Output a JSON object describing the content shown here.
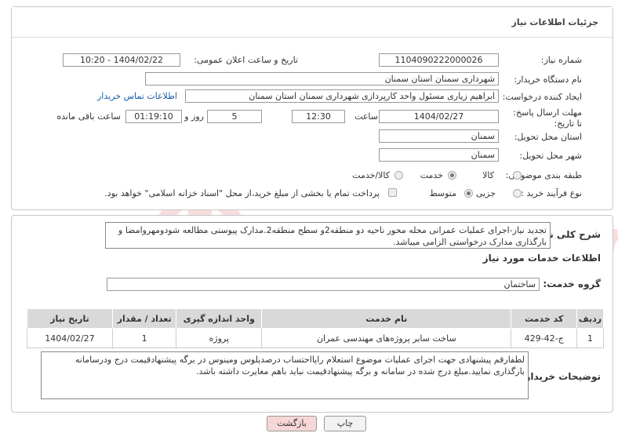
{
  "header": {
    "title": "جزئیات اطلاعات نیاز"
  },
  "form": {
    "need_number_label": "شماره نیاز:",
    "need_number": "1104090222000026",
    "announce_label": "تاریخ و ساعت اعلان عمومی:",
    "announce_value": "1404/02/22 - 10:20",
    "buyer_org_label": "نام دستگاه خریدار:",
    "buyer_org": "شهرداری سمنان استان سمنان",
    "creator_label": "ایجاد کننده درخواست:",
    "creator": "ابراهیم زیاری مسئول واحد کارپردازی شهرداری سمنان استان سمنان",
    "contact_link": "اطلاعات تماس خریدار",
    "deadline_label": "مهلت ارسال پاسخ: تا تاریخ:",
    "deadline_date": "1404/02/27",
    "time_label": "ساعت",
    "deadline_time": "12:30",
    "days_value": "5",
    "days_label": "روز و",
    "remaining_time": "01:19:10",
    "remaining_label": "ساعت باقی مانده",
    "province_label": "استان محل تحویل:",
    "province": "سمنان",
    "city_label": "شهر محل تحویل:",
    "city": "سمنان",
    "category_label": "طبقه بندی موضوعی:",
    "category_options": [
      "کالا",
      "خدمت",
      "کالا/خدمت"
    ],
    "category_selected": "خدمت",
    "process_label": "نوع فرآیند خرید :",
    "process_options": [
      "جزیی",
      "متوسط"
    ],
    "process_selected": "متوسط",
    "payment_text": "پرداخت تمام یا بخشی از مبلغ خرید،از محل \"اسناد خزانه اسلامی\" خواهد بود."
  },
  "summary": {
    "label": "شرح کلی نیاز:",
    "text": "تجدید نیاز-اجرای عملیات عمرانی محله محور ناحیه دو منطقه2و سطح منطقه2.مدارک پیوستی مطالعه شودومهروامضا و بارگذاری مدارک درخواستی الزامی میباشد."
  },
  "services": {
    "section_title": "اطلاعات خدمات مورد نیاز",
    "group_label": "گروه خدمت:",
    "group_value": "ساختمان",
    "columns": [
      "ردیف",
      "کد خدمت",
      "نام خدمت",
      "واحد اندازه گیری",
      "تعداد / مقدار",
      "تاریخ نیاز"
    ],
    "rows": [
      {
        "row": "1",
        "code": "ج-42-429",
        "name": "ساخت سایر پروژه‌های مهندسی عمران",
        "unit": "پروژه",
        "qty": "1",
        "date": "1404/02/27"
      }
    ]
  },
  "buyer_notes": {
    "label": "توضیحات خریدار:",
    "text": "لطفارقم پیشنهادی جهت اجرای عملیات موضوع استعلام راپااحتساب درصدپلوس ومینوس در برگه پیشنهادقیمت درج ودرسامانه بارگذاری نمایید.مبلغ درج شده در سامانه و برگه پیشنهادقیمت نباید باهم مغایرت داشته باشد."
  },
  "buttons": {
    "print": "چاپ",
    "back": "بازگشت"
  },
  "colors": {
    "back_button_bg": "#f6d6d6",
    "link": "#1a5ca8",
    "table_header": "#d9d9d9"
  }
}
